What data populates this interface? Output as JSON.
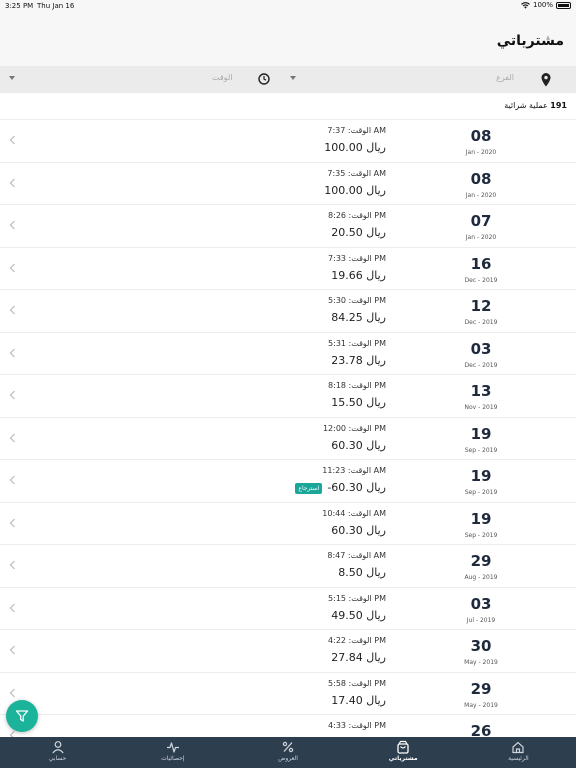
{
  "status": {
    "time": "3:25 PM",
    "date": "Thu Jan 16",
    "battery": "100%"
  },
  "header": {
    "title": "مشترياتي"
  },
  "filters": {
    "branch_placeholder": "الفرع",
    "time_placeholder": "الوقت"
  },
  "summary": {
    "count": "191",
    "label": "عملية شرائية"
  },
  "labels": {
    "time_prefix": "الوقت:",
    "currency": "ريال"
  },
  "purchases": [
    {
      "day": "08",
      "month": "Jan - 2020",
      "time": "7:37 AM",
      "amount": "100.00"
    },
    {
      "day": "08",
      "month": "Jan - 2020",
      "time": "7:35 AM",
      "amount": "100.00"
    },
    {
      "day": "07",
      "month": "Jan - 2020",
      "time": "8:26 PM",
      "amount": "20.50"
    },
    {
      "day": "16",
      "month": "Dec - 2019",
      "time": "7:33 PM",
      "amount": "19.66"
    },
    {
      "day": "12",
      "month": "Dec - 2019",
      "time": "5:30 PM",
      "amount": "84.25"
    },
    {
      "day": "03",
      "month": "Dec - 2019",
      "time": "5:31 PM",
      "amount": "23.78"
    },
    {
      "day": "13",
      "month": "Nov - 2019",
      "time": "8:18 PM",
      "amount": "15.50"
    },
    {
      "day": "19",
      "month": "Sep - 2019",
      "time": "12:00 PM",
      "amount": "60.30"
    },
    {
      "day": "19",
      "month": "Sep - 2019",
      "time": "11:23 AM",
      "amount": "-60.30",
      "badge": "استرجاع"
    },
    {
      "day": "19",
      "month": "Sep - 2019",
      "time": "10:44 AM",
      "amount": "60.30"
    },
    {
      "day": "29",
      "month": "Aug - 2019",
      "time": "8:47 AM",
      "amount": "8.50"
    },
    {
      "day": "03",
      "month": "Jul - 2019",
      "time": "5:15 PM",
      "amount": "49.50"
    },
    {
      "day": "30",
      "month": "May - 2019",
      "time": "4:22 PM",
      "amount": "27.84"
    },
    {
      "day": "29",
      "month": "May - 2019",
      "time": "5:58 PM",
      "amount": "17.40"
    },
    {
      "day": "26",
      "month": "",
      "time": "4:33 PM",
      "amount": ""
    }
  ],
  "tabs": [
    {
      "label": "الرئيسية",
      "icon": "home-icon",
      "active": false
    },
    {
      "label": "مشترياتي",
      "icon": "bag-icon",
      "active": true
    },
    {
      "label": "العروض",
      "icon": "percent-icon",
      "active": false
    },
    {
      "label": "إحصائيات",
      "icon": "pulse-icon",
      "active": false
    },
    {
      "label": "حسابي",
      "icon": "user-icon",
      "active": false
    }
  ],
  "colors": {
    "accent": "#1bb39a",
    "tabbar": "#2d3e4f",
    "badge": "#1aa79a"
  }
}
